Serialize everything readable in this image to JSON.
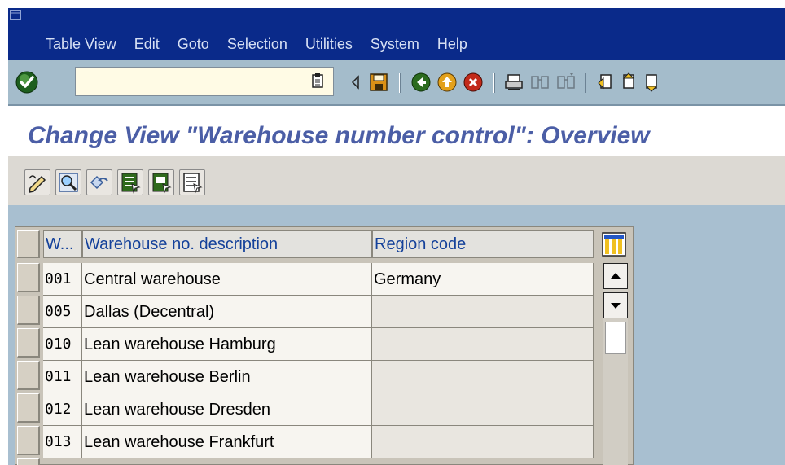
{
  "menu": {
    "items": [
      {
        "u": "T",
        "rest": "able View"
      },
      {
        "u": "E",
        "rest": "dit"
      },
      {
        "u": "G",
        "rest": "oto"
      },
      {
        "u": "S",
        "rest": "election"
      },
      {
        "u": "",
        "rest": "Utilities"
      },
      {
        "u": "",
        "rest": "System"
      },
      {
        "u": "H",
        "rest": "elp"
      }
    ]
  },
  "toolbar": {
    "command_value": "",
    "icons": [
      "enter-icon",
      "save-icon",
      "back-icon",
      "exit-icon",
      "cancel-icon",
      "print-icon",
      "find-icon",
      "find-next-icon",
      "first-page-icon",
      "previous-page-icon",
      "next-page-icon"
    ]
  },
  "title": "Change View \"Warehouse number control\": Overview",
  "app_toolbar": {
    "icons": [
      "display-change-icon",
      "details-icon",
      "undo-icon",
      "select-all-icon",
      "select-block-icon",
      "deselect-all-icon"
    ]
  },
  "table": {
    "headers": [
      "W...",
      "Warehouse no. description",
      "Region code"
    ],
    "rows": [
      {
        "w": "001",
        "desc": "Central warehouse",
        "region": "Germany"
      },
      {
        "w": "005",
        "desc": "Dallas (Decentral)",
        "region": ""
      },
      {
        "w": "010",
        "desc": "Lean warehouse Hamburg",
        "region": ""
      },
      {
        "w": "011",
        "desc": "Lean warehouse Berlin",
        "region": ""
      },
      {
        "w": "012",
        "desc": "Lean warehouse Dresden",
        "region": ""
      },
      {
        "w": "013",
        "desc": "Lean warehouse Frankfurt",
        "region": ""
      }
    ]
  },
  "colors": {
    "menubar": "#0a2a8a",
    "title": "#4b5ea6",
    "header_text": "#14419a"
  }
}
